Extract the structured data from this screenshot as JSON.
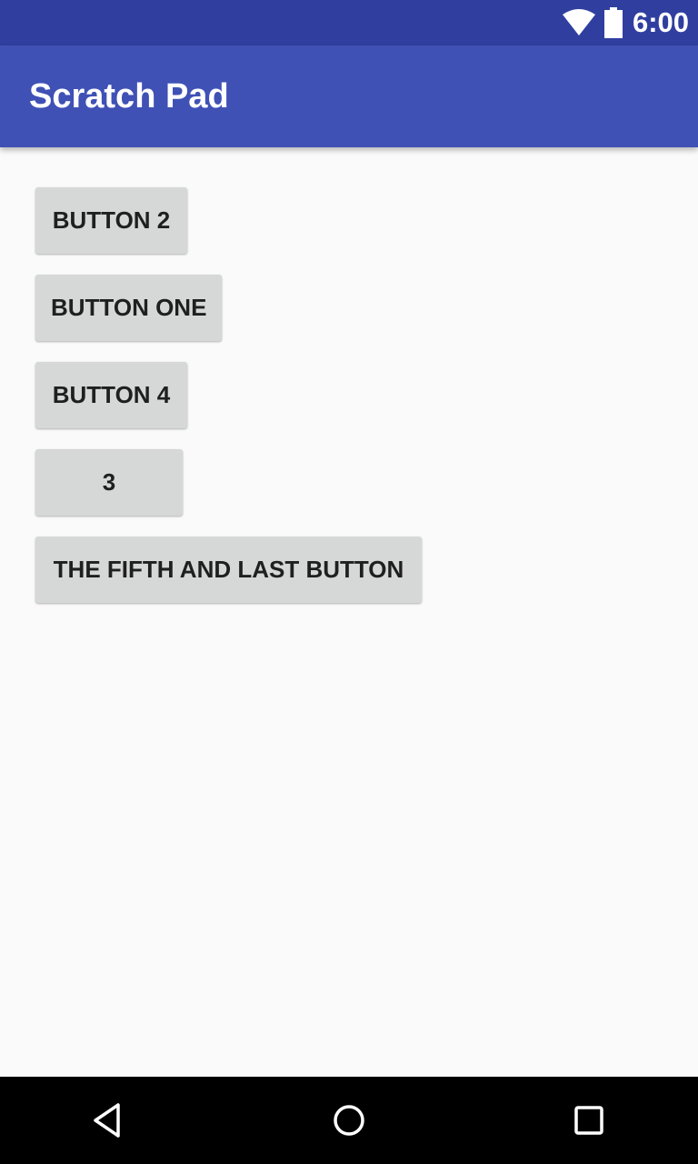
{
  "status_bar": {
    "time": "6:00",
    "icons": [
      "wifi-icon",
      "battery-icon"
    ]
  },
  "app_bar": {
    "title": "Scratch Pad",
    "color": "#3f51b5",
    "status_color": "#303f9f"
  },
  "buttons": [
    {
      "label": "BUTTON 2"
    },
    {
      "label": "BUTTON ONE"
    },
    {
      "label": "BUTTON 4"
    },
    {
      "label": "3"
    },
    {
      "label": "THE FIFTH AND LAST BUTTON"
    }
  ],
  "nav_bar": {
    "icons": [
      "back-icon",
      "home-icon",
      "recent-apps-icon"
    ]
  }
}
